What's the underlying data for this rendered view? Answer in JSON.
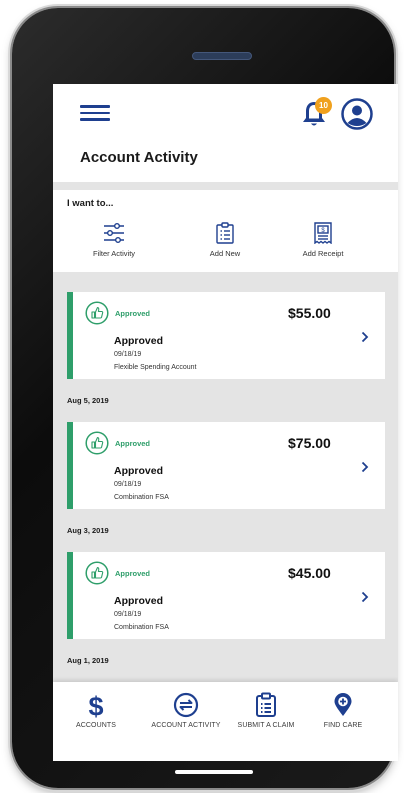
{
  "header": {
    "notification_count": "10",
    "page_title": "Account Activity"
  },
  "actions": {
    "heading": "I want to...",
    "items": [
      {
        "label": "Filter Activity",
        "icon": "sliders-icon"
      },
      {
        "label": "Add New",
        "icon": "clipboard-list-icon"
      },
      {
        "label": "Add Receipt",
        "icon": "receipt-icon"
      }
    ]
  },
  "activity": [
    {
      "status": "Approved",
      "title": "Approved",
      "amount": "$55.00",
      "date": "09/18/19",
      "account": "Flexible Spending Account"
    },
    {
      "date_header": "Aug 5, 2019",
      "status": "Approved",
      "title": "Approved",
      "amount": "$75.00",
      "date": "09/18/19",
      "account": "Combination FSA"
    },
    {
      "date_header": "Aug 3, 2019",
      "status": "Approved",
      "title": "Approved",
      "amount": "$45.00",
      "date": "09/18/19",
      "account": "Combination FSA"
    }
  ],
  "last_date_header": "Aug 1, 2019",
  "nav": [
    {
      "label": "ACCOUNTS",
      "icon": "dollar-icon"
    },
    {
      "label": "ACCOUNT ACTIVITY",
      "icon": "exchange-icon"
    },
    {
      "label": "SUBMIT A CLAIM",
      "icon": "clipboard-icon"
    },
    {
      "label": "FIND CARE",
      "icon": "location-pin-icon"
    }
  ],
  "colors": {
    "primary": "#1e3f8f",
    "approved": "#2e9e6a",
    "badge": "#f0a11e",
    "background": "#e4e4e4"
  }
}
